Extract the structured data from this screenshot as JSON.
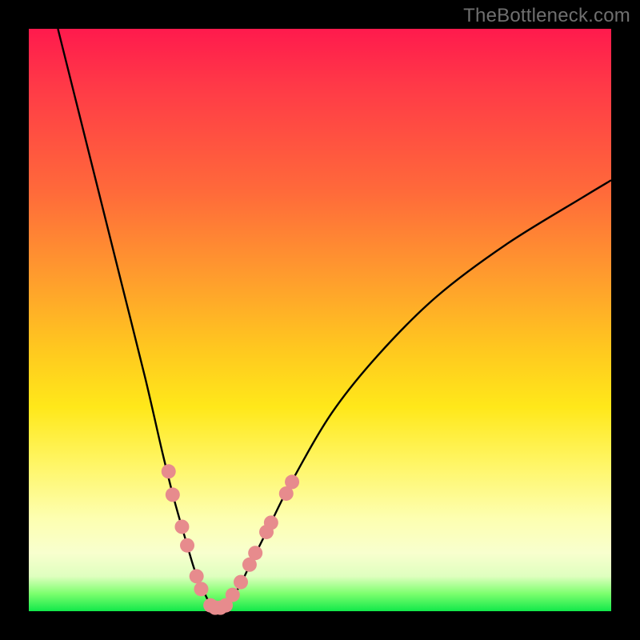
{
  "watermark": "TheBottleneck.com",
  "chart_data": {
    "type": "line",
    "title": "",
    "xlabel": "",
    "ylabel": "",
    "xlim": [
      0,
      100
    ],
    "ylim": [
      0,
      100
    ],
    "grid": false,
    "legend": false,
    "series": [
      {
        "name": "bottleneck-curve",
        "color": "#000000",
        "x": [
          5,
          8,
          12,
          16,
          20,
          23,
          25,
          27,
          28.5,
          30,
          31,
          32,
          33,
          34,
          36,
          38,
          41,
          45,
          52,
          60,
          70,
          82,
          95,
          100
        ],
        "values": [
          100,
          88,
          72,
          56,
          40,
          27,
          19,
          12,
          7,
          3.5,
          1.5,
          0.6,
          0.6,
          1.4,
          4,
          8,
          14,
          22,
          34,
          44,
          54,
          63,
          71,
          74
        ]
      }
    ],
    "markers": {
      "name": "highlight-dots",
      "color": "#e78b8d",
      "radius_px": 9,
      "points": [
        {
          "x": 24.0,
          "y": 24.0
        },
        {
          "x": 24.7,
          "y": 20.0
        },
        {
          "x": 26.3,
          "y": 14.5
        },
        {
          "x": 27.2,
          "y": 11.3
        },
        {
          "x": 28.8,
          "y": 6.0
        },
        {
          "x": 29.6,
          "y": 3.8
        },
        {
          "x": 31.2,
          "y": 1.0
        },
        {
          "x": 32.0,
          "y": 0.6
        },
        {
          "x": 32.9,
          "y": 0.6
        },
        {
          "x": 33.8,
          "y": 1.0
        },
        {
          "x": 35.0,
          "y": 2.8
        },
        {
          "x": 36.4,
          "y": 5.0
        },
        {
          "x": 37.9,
          "y": 8.0
        },
        {
          "x": 38.9,
          "y": 10.0
        },
        {
          "x": 40.8,
          "y": 13.6
        },
        {
          "x": 41.6,
          "y": 15.2
        },
        {
          "x": 44.2,
          "y": 20.2
        },
        {
          "x": 45.2,
          "y": 22.2
        }
      ]
    }
  }
}
